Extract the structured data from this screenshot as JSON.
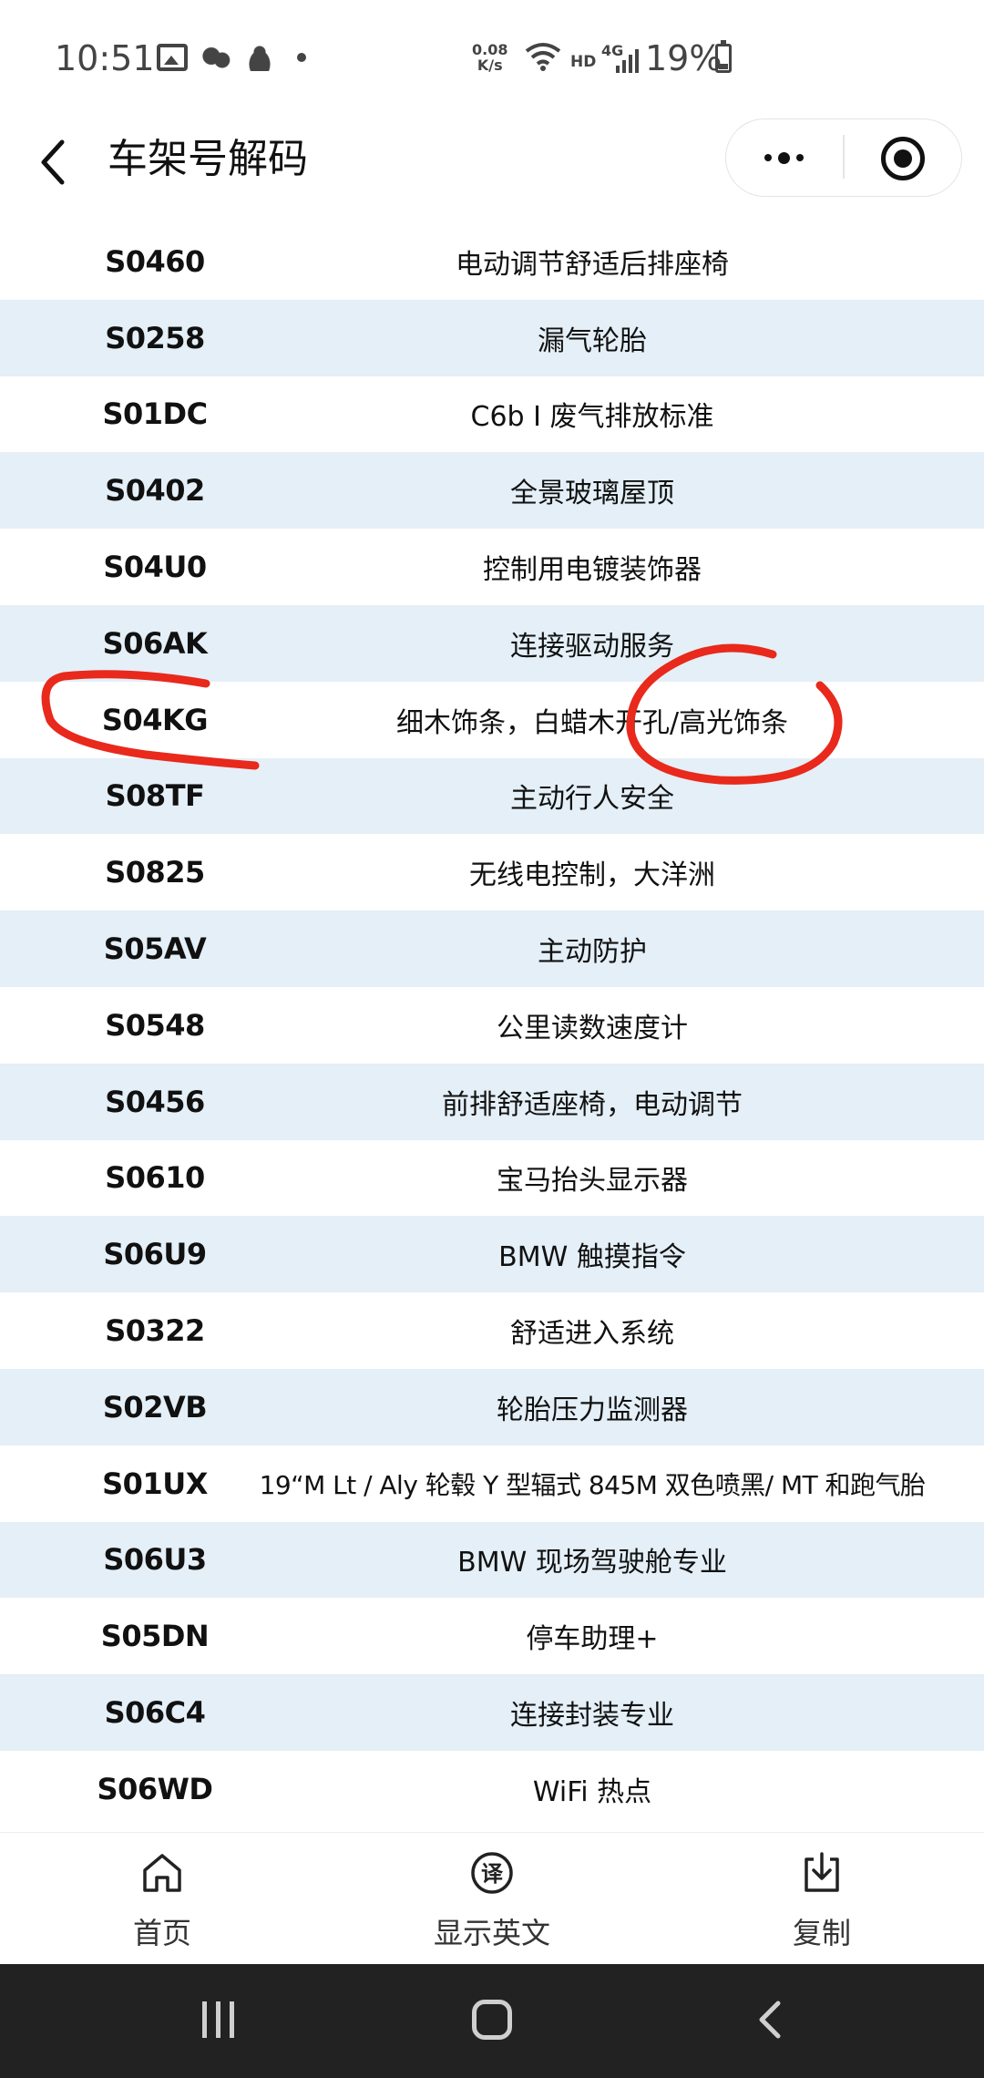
{
  "status_bar": {
    "time": "10:51",
    "net_speed_top": "0.08",
    "net_speed_bottom": "K/s",
    "hd": "HD",
    "network_type": "4G",
    "battery": "19%"
  },
  "navbar": {
    "title": "车架号解码"
  },
  "options": [
    {
      "code": "S0460",
      "desc": "电动调节舒适后排座椅"
    },
    {
      "code": "S0258",
      "desc": "漏气轮胎"
    },
    {
      "code": "S01DC",
      "desc": "C6b I 废气排放标准"
    },
    {
      "code": "S0402",
      "desc": "全景玻璃屋顶"
    },
    {
      "code": "S04U0",
      "desc": "控制用电镀装饰器"
    },
    {
      "code": "S06AK",
      "desc": "连接驱动服务"
    },
    {
      "code": "S04KG",
      "desc": "细木饰条，白蜡木开孔/高光饰条"
    },
    {
      "code": "S08TF",
      "desc": "主动行人安全"
    },
    {
      "code": "S0825",
      "desc": "无线电控制，大洋洲"
    },
    {
      "code": "S05AV",
      "desc": "主动防护"
    },
    {
      "code": "S0548",
      "desc": "公里读数速度计"
    },
    {
      "code": "S0456",
      "desc": "前排舒适座椅，电动调节"
    },
    {
      "code": "S0610",
      "desc": "宝马抬头显示器"
    },
    {
      "code": "S06U9",
      "desc": "BMW 触摸指令"
    },
    {
      "code": "S0322",
      "desc": "舒适进入系统"
    },
    {
      "code": "S02VB",
      "desc": "轮胎压力监测器"
    },
    {
      "code": "S01UX",
      "desc": "19“M Lt / Aly 轮毂 Y 型辐式 845M 双色喷黑/ MT 和跑气胎"
    },
    {
      "code": "S06U3",
      "desc": "BMW 现场驾驶舱专业"
    },
    {
      "code": "S05DN",
      "desc": "停车助理+"
    },
    {
      "code": "S06C4",
      "desc": "连接封装专业"
    },
    {
      "code": "S06WD",
      "desc": "WiFi 热点"
    }
  ],
  "tabbar": {
    "home": "首页",
    "translate": "显示英文",
    "copy": "复制"
  },
  "colors": {
    "alt_row": "#e4eff7",
    "annotation": "#e8291c"
  }
}
